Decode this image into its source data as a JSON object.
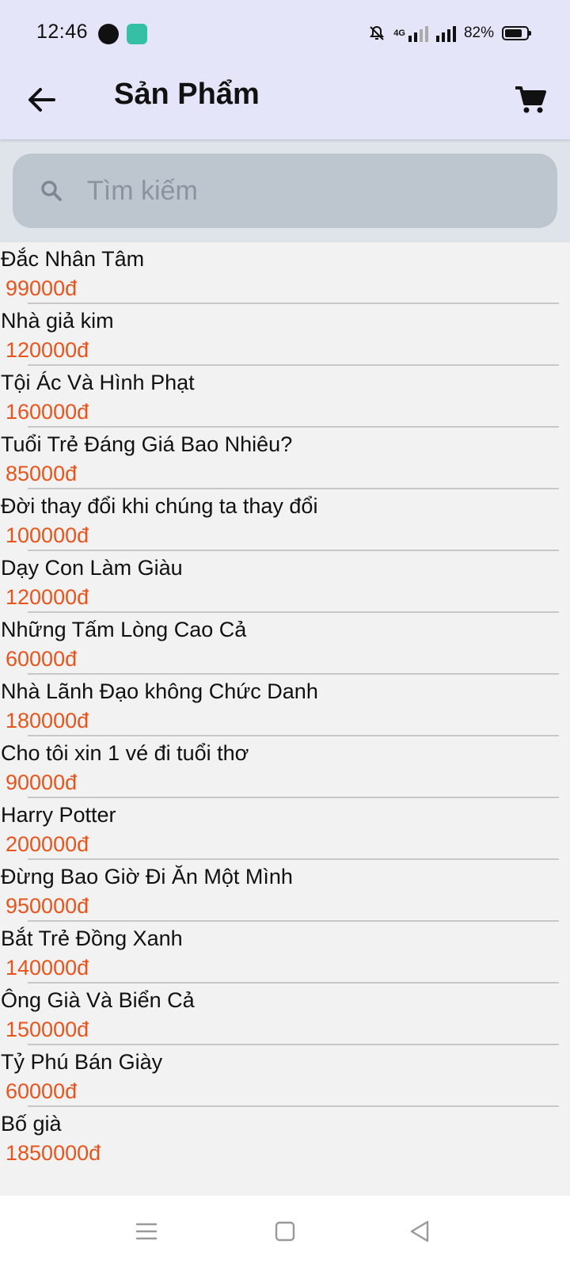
{
  "status_bar": {
    "time": "12:46",
    "network": "4G",
    "battery": "82%"
  },
  "app_bar": {
    "title": "Sản Phẩm",
    "back_icon": "arrow-left-icon",
    "cart_icon": "cart-icon"
  },
  "search": {
    "placeholder": "Tìm kiếm",
    "value": ""
  },
  "products": [
    {
      "name": "Đắc Nhân Tâm",
      "price": "99000đ"
    },
    {
      "name": "Nhà giả kim",
      "price": "120000đ"
    },
    {
      "name": "Tội Ác Và Hình Phạt",
      "price": "160000đ"
    },
    {
      "name": "Tuổi Trẻ Đáng Giá Bao Nhiêu?",
      "price": "85000đ"
    },
    {
      "name": "Đời thay đổi khi chúng ta thay đổi",
      "price": "100000đ"
    },
    {
      "name": "Dạy Con Làm Giàu",
      "price": "120000đ"
    },
    {
      "name": "Những Tấm Lòng Cao Cả",
      "price": "60000đ"
    },
    {
      "name": "Nhà Lãnh Đạo không Chức Danh",
      "price": "180000đ"
    },
    {
      "name": "Cho tôi xin 1 vé đi tuổi thơ",
      "price": "90000đ"
    },
    {
      "name": "Harry Potter",
      "price": "200000đ"
    },
    {
      "name": "Đừng Bao Giờ Đi Ăn Một Mình",
      "price": "950000đ"
    },
    {
      "name": "Bắt Trẻ Đồng Xanh",
      "price": "140000đ"
    },
    {
      "name": "Ông Già Và Biển Cả",
      "price": "150000đ"
    },
    {
      "name": "Tỷ Phú Bán Giày",
      "price": "60000đ"
    },
    {
      "name": "Bố già",
      "price": "1850000đ"
    }
  ],
  "colors": {
    "app_bar_bg": "#e4e5f9",
    "price": "#e8541c",
    "search_bg": "#bdc5cf"
  }
}
